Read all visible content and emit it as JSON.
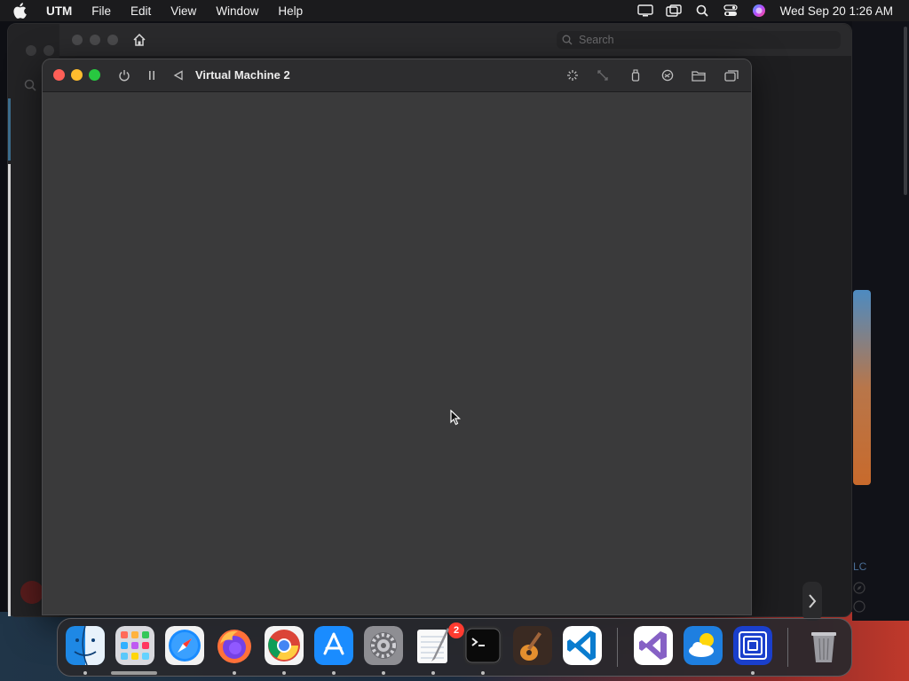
{
  "menubar": {
    "app_name": "UTM",
    "items": [
      "File",
      "Edit",
      "View",
      "Window",
      "Help"
    ],
    "clock": "Wed Sep 20  1:26 AM",
    "status_icons": [
      "display-icon",
      "window-switch-icon",
      "spotlight-icon",
      "control-center-icon",
      "siri-icon"
    ]
  },
  "background_window": {
    "search_placeholder": "Search",
    "side_text": "LC"
  },
  "vm_window": {
    "title": "Virtual Machine 2",
    "toolbar_icons": [
      "power-icon",
      "pause-icon",
      "back-icon",
      "display-settings-icon",
      "resize-icon",
      "usb-icon",
      "share-icon",
      "folder-icon",
      "windows-icon"
    ]
  },
  "dock": {
    "apps": [
      "Finder",
      "Launchpad",
      "Safari",
      "Firefox",
      "Chrome",
      "App Store",
      "System Settings",
      "TextEdit",
      "Terminal",
      "GarageBand",
      "Visual Studio Code",
      "Visual Studio",
      "Weather",
      "UTM",
      "Trash"
    ],
    "settings_badge": "2"
  },
  "colors": {
    "close": "#ff5f57",
    "minimize": "#febc2e",
    "maximize": "#28c840",
    "badge": "#ff3b30"
  }
}
